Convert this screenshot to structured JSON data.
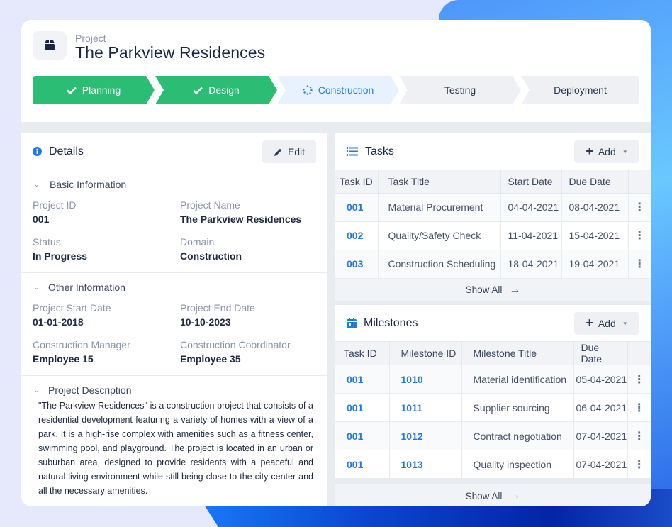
{
  "header": {
    "kicker": "Project",
    "title": "The Parkview Residences",
    "icon": "box-icon"
  },
  "stepper": [
    {
      "label": "Planning",
      "state": "done",
      "icon": "check-icon"
    },
    {
      "label": "Design",
      "state": "done",
      "icon": "check-icon"
    },
    {
      "label": "Construction",
      "state": "active",
      "icon": "spinner-icon"
    },
    {
      "label": "Testing",
      "state": "todo"
    },
    {
      "label": "Deployment",
      "state": "todo"
    }
  ],
  "details": {
    "title": "Details",
    "edit_label": "Edit",
    "basic": {
      "heading": "Basic Information",
      "fields": [
        {
          "label": "Project ID",
          "value": "001"
        },
        {
          "label": "Project Name",
          "value": "The Parkview Residences"
        },
        {
          "label": "Status",
          "value": "In Progress"
        },
        {
          "label": "Domain",
          "value": "Construction"
        }
      ]
    },
    "other": {
      "heading": "Other Information",
      "fields": [
        {
          "label": "Project Start Date",
          "value": "01-01-2018"
        },
        {
          "label": "Project End Date",
          "value": "10-10-2023"
        },
        {
          "label": "Construction Manager",
          "value": "Employee 15"
        },
        {
          "label": "Construction Coordinator",
          "value": "Employee 35"
        }
      ]
    },
    "description": {
      "heading": "Project Description",
      "text": "\"The Parkview Residences\" is a construction project that consists of a residential development featuring a variety of homes with a view of a park. It is a high-rise complex with amenities such as a fitness center, swimming pool, and playground. The project is located in an urban or suburban area, designed to provide residents with a peaceful and natural living environment while still being close to the city center and all the necessary amenities."
    }
  },
  "tasks": {
    "title": "Tasks",
    "add_label": "Add",
    "columns": [
      "Task ID",
      "Task Title",
      "Start Date",
      "Due Date",
      ""
    ],
    "rows": [
      {
        "id": "001",
        "title": "Material Procurement",
        "start": "04-04-2021",
        "due": "08-04-2021"
      },
      {
        "id": "002",
        "title": "Quality/Safety Check",
        "start": "11-04-2021",
        "due": "15-04-2021"
      },
      {
        "id": "003",
        "title": "Construction Scheduling",
        "start": "18-04-2021",
        "due": "19-04-2021"
      }
    ],
    "show_all": "Show All"
  },
  "milestones": {
    "title": "Milestones",
    "add_label": "Add",
    "columns": [
      "Task ID",
      "Milestone ID",
      "Milestone Title",
      "Due Date",
      ""
    ],
    "rows": [
      {
        "task_id": "001",
        "milestone_id": "1010",
        "title": "Material identification",
        "due": "05-04-2021"
      },
      {
        "task_id": "001",
        "milestone_id": "1011",
        "title": "Supplier sourcing",
        "due": "06-04-2021"
      },
      {
        "task_id": "001",
        "milestone_id": "1012",
        "title": "Contract negotiation",
        "due": "07-04-2021"
      },
      {
        "task_id": "001",
        "milestone_id": "1013",
        "title": "Quality inspection",
        "due": "07-04-2021"
      }
    ],
    "show_all": "Show All"
  },
  "colors": {
    "accent": "#1f7ae0",
    "done": "#2bbd74",
    "active_bg": "#e8f2fe"
  }
}
